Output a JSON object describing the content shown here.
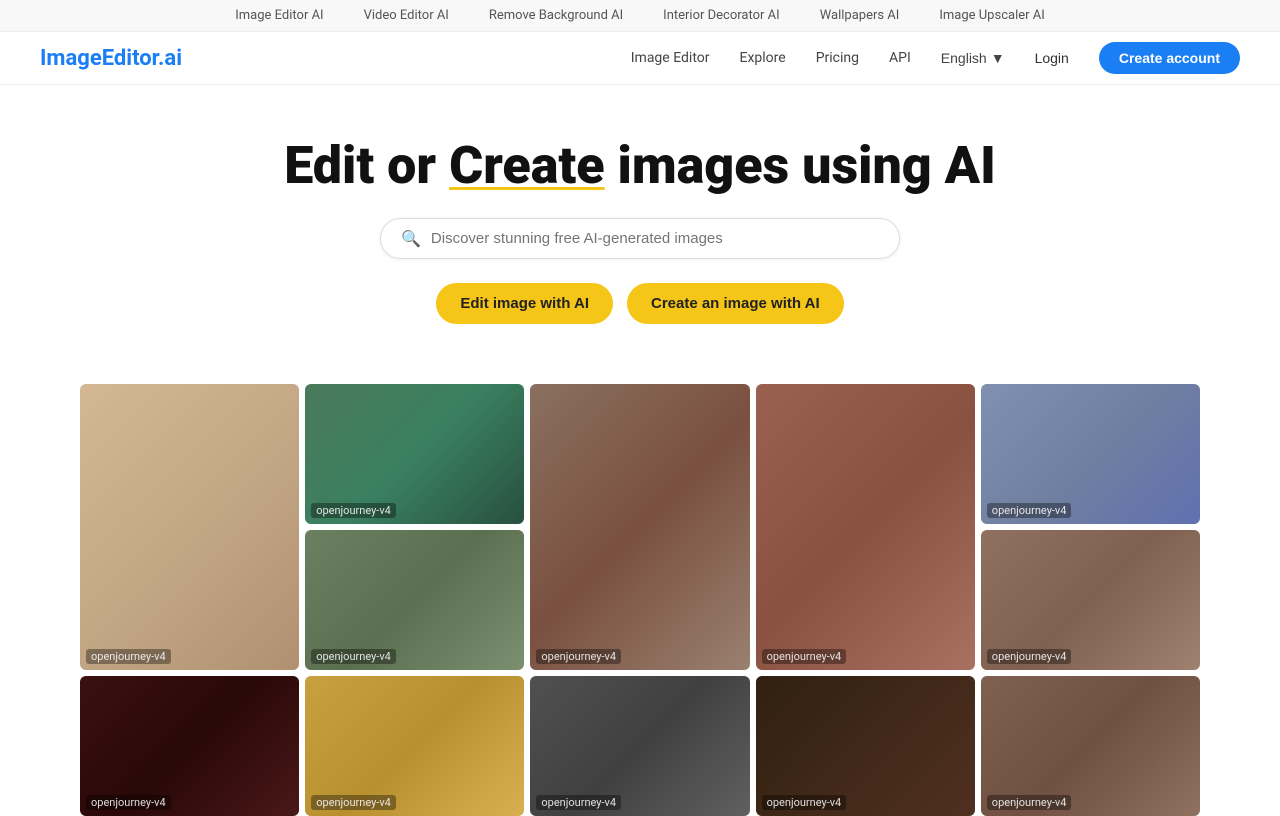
{
  "top_bar": {
    "links": [
      {
        "label": "Image Editor AI",
        "id": "image-editor-ai"
      },
      {
        "label": "Video Editor AI",
        "id": "video-editor-ai"
      },
      {
        "label": "Remove Background AI",
        "id": "remove-bg-ai"
      },
      {
        "label": "Interior Decorator AI",
        "id": "interior-decorator-ai"
      },
      {
        "label": "Wallpapers AI",
        "id": "wallpapers-ai"
      },
      {
        "label": "Image Upscaler AI",
        "id": "image-upscaler-ai"
      }
    ]
  },
  "nav": {
    "logo": "ImageEditor.ai",
    "links": [
      {
        "label": "Image Editor",
        "id": "image-editor"
      },
      {
        "label": "Explore",
        "id": "explore"
      },
      {
        "label": "Pricing",
        "id": "pricing"
      },
      {
        "label": "API",
        "id": "api"
      }
    ],
    "language": "English",
    "login": "Login",
    "create_account": "Create account"
  },
  "hero": {
    "title_part1": "Edit or ",
    "title_create": "Create",
    "title_part2": " images using AI",
    "search_placeholder": "Discover stunning free AI-generated images",
    "cta_edit": "Edit image with AI",
    "cta_create": "Create an image with AI"
  },
  "gallery": {
    "label": "openjourney-v4",
    "images": [
      {
        "id": "img1",
        "bg": "#b8a080",
        "label": "openjourney-v4",
        "row": 1,
        "col": 1
      },
      {
        "id": "img2",
        "bg": "#5a7a5a",
        "label": "openjourney-v4",
        "row": 1,
        "col": 2
      },
      {
        "id": "img3",
        "bg": "#8a7060",
        "label": "openjourney-v4",
        "row": 1,
        "col": 3
      },
      {
        "id": "img4",
        "bg": "#9a6050",
        "label": "openjourney-v4",
        "row": 1,
        "col": 4
      },
      {
        "id": "img5",
        "bg": "#6080a0",
        "label": "openjourney-v4",
        "row": 1,
        "col": 5
      },
      {
        "id": "img6",
        "bg": "#7a9060",
        "label": "openjourney-v4",
        "row": 2,
        "col": 1
      },
      {
        "id": "img7",
        "bg": "#3a1010",
        "label": "openjourney-v4",
        "row": 2,
        "col": 2
      },
      {
        "id": "img8",
        "bg": "#8a8060",
        "label": "openjourney-v4",
        "row": 2,
        "col": 5
      },
      {
        "id": "img9",
        "bg": "#6070a0",
        "label": "openjourney-v4",
        "row": 3,
        "col": 1
      },
      {
        "id": "img10",
        "bg": "#504040",
        "label": "openjourney-v4",
        "row": 3,
        "col": 2
      },
      {
        "id": "img11",
        "bg": "#204060",
        "label": "openjourney-v4",
        "row": 3,
        "col": 3
      },
      {
        "id": "img12",
        "bg": "#806040",
        "label": "openjourney-v4",
        "row": 3,
        "col": 4
      },
      {
        "id": "img13",
        "bg": "#408060",
        "label": "openjourney-v4",
        "row": 3,
        "col": 5
      }
    ]
  }
}
